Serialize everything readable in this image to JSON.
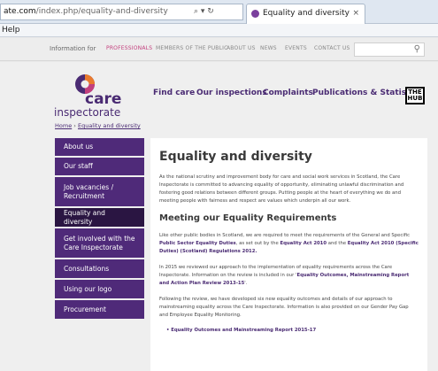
{
  "browser": {
    "address_host": "ate.com",
    "address_path": "/index.php/equality-and-diversity",
    "address_icons": "⌕ ▾ ↻",
    "tab_title": "Equality and diversity",
    "tab_close": "×",
    "menu_help": "Help"
  },
  "topnav": {
    "label": "Information for",
    "items": [
      "PROFESSIONALS",
      "MEMBERS OF THE PUBLIC",
      "ABOUT US",
      "NEWS",
      "EVENTS",
      "CONTACT US"
    ],
    "active_index": 0,
    "search_icon": "search-icon"
  },
  "logo": {
    "line1": "care",
    "line2": "inspectorate",
    "colors": {
      "purple": "#4a2b73",
      "orange": "#e97a2e",
      "pink": "#c33f7d"
    }
  },
  "mainnav": [
    "Find care",
    "Our inspections",
    "Complaints",
    "Publications & Statistics"
  ],
  "hub_logo": {
    "line1": "THE",
    "line2": "HUB"
  },
  "breadcrumb": {
    "home": "Home",
    "separator": "›",
    "current": "Equality and diversity"
  },
  "sidebar": {
    "items": [
      "About us",
      "Our staff",
      "Job vacancies / Recruitment",
      "Equality and diversity",
      "Get involved with the Care Inspectorate",
      "Consultations",
      "Using our logo",
      "Procurement"
    ],
    "active_index": 3
  },
  "content": {
    "title": "Equality and diversity",
    "intro": "As the national scrutiny and improvement body for care and social work services in Scotland, the Care Inspectorate is committed to advancing equality of opportunity, eliminating unlawful discrimination and fostering good relations between different groups. Putting people at the heart of everything we do and meeting people with fairness and respect are values which underpin all our work.",
    "heading": "Meeting our Equality Requirements",
    "para2_a": "Like other public bodies in Scotland, we are required to meet the requirements of the General and Specific ",
    "para2_b1": "Public Sector Equality Duties",
    "para2_c": ", as set out by the ",
    "para2_b2": "Equality Act 2010",
    "para2_d": " and the ",
    "para2_b3": "Equality Act 2010 (Specific Duties) (Scotland) Regulations 2012.",
    "para3_a": "In 2015 we reviewed our approach to the implementation of equality requirements across the Care Inspectorate. Information on the review is included in our '",
    "para3_b": "Equality Outcomes, Mainstreaming Report and Action Plan Review 2013-15",
    "para3_c": "'.",
    "para4": "Following the review, we have developed six new equality outcomes and details of our approach to mainstreaming equality across the Care Inspectorate. Information is also provided on our Gender Pay Gap and Employee Equality Monitoring.",
    "bullet1": "•  Equality Outcomes and Mainstreaming Report 2015-17"
  }
}
